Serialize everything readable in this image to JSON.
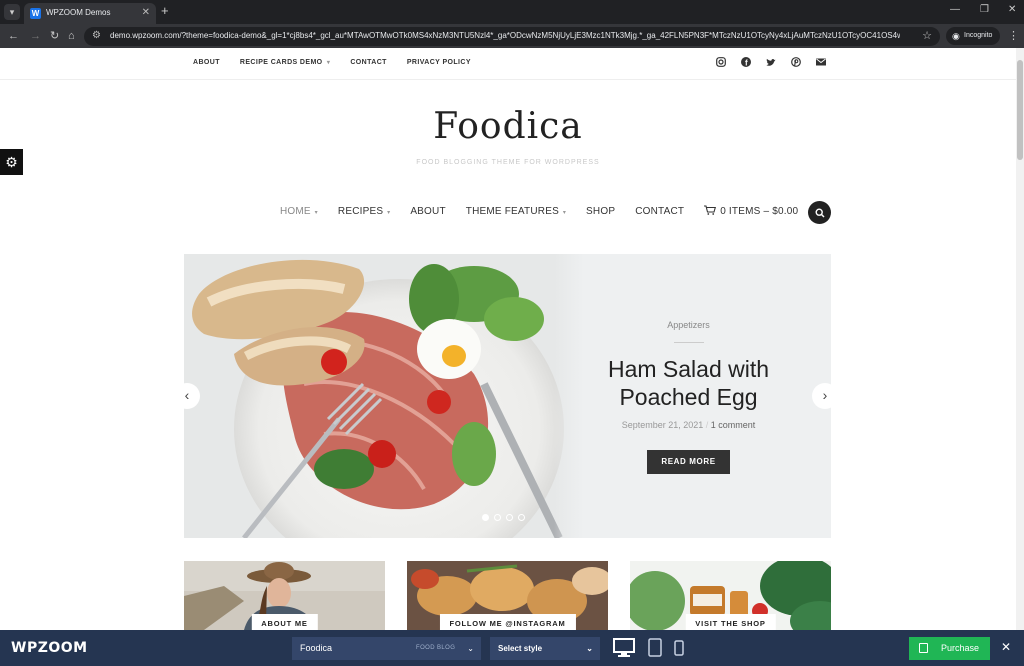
{
  "browser": {
    "tab_title": "WPZOOM Demos",
    "tab_favicon": "W",
    "url": "demo.wpzoom.com/?theme=foodica-demo&_gl=1*cj8bs4*_gcl_au*MTAwOTMwOTk0MS4xNzM3NTU5Nzl4*_ga*ODcwNzM5NjUyLjE3Mzc1NTk3Mjg.*_ga_42FLN5PN3F*MTczNzU1OTcyNy4xLjAuMTczNzU1OTcyOC41OS4wLjA.",
    "incognito_label": "Incognito"
  },
  "topbar": {
    "links": [
      "ABOUT",
      "RECIPE CARDS DEMO",
      "CONTACT",
      "PRIVACY POLICY"
    ],
    "socials": [
      "instagram-icon",
      "facebook-icon",
      "twitter-icon",
      "pinterest-icon",
      "email-icon"
    ]
  },
  "site": {
    "logo": "Foodica",
    "tagline": "FOOD BLOGGING THEME FOR WORDPRESS"
  },
  "nav": {
    "items": [
      "HOME",
      "RECIPES",
      "ABOUT",
      "THEME FEATURES",
      "SHOP",
      "CONTACT"
    ],
    "cart": "0 ITEMS – $0.00"
  },
  "hero": {
    "category": "Appetizers",
    "title_line1": "Ham Salad with",
    "title_line2": "Poached Egg",
    "date": "September 21, 2021",
    "comments": "1 comment",
    "button": "READ MORE",
    "slide_count": 4,
    "active_slide": 1
  },
  "cards": [
    {
      "label": "ABOUT ME"
    },
    {
      "label": "FOLLOW ME @INSTAGRAM"
    },
    {
      "label": "VISIT THE SHOP"
    }
  ],
  "panel": {
    "brand": "WPZOOM",
    "theme_name": "Foodica",
    "theme_type": "FOOD BLOG",
    "style_placeholder": "Select style",
    "purchase": "Purchase",
    "accent": "#20b655",
    "background": "#253551"
  }
}
